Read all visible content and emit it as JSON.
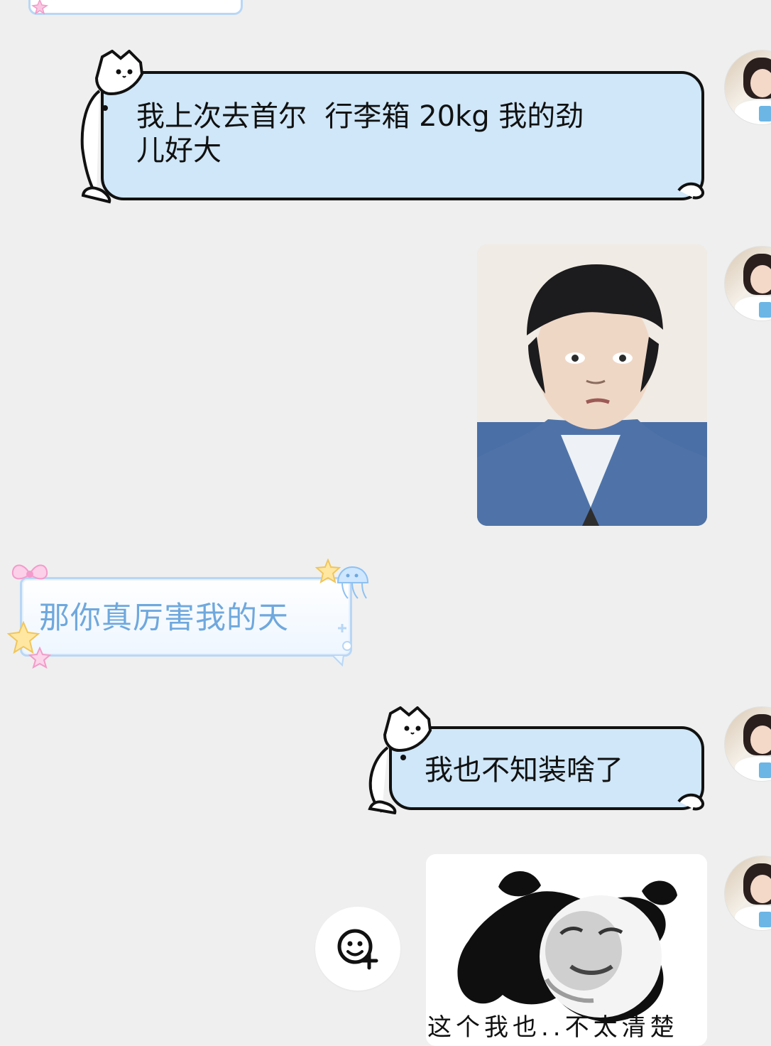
{
  "messages": {
    "m1": {
      "text": "我上次去首尔  行李箱 20kg 我的劲\n儿好大"
    },
    "m2": {
      "text": "那你真厉害我的天"
    },
    "m3": {
      "text": "我也不知装啥了"
    },
    "m4": {
      "caption": "这个我也..不太清楚"
    }
  },
  "icons": {
    "avatar": "avatar",
    "emoji_add": "emoji-add-icon",
    "bow": "bow-icon",
    "star": "star-icon",
    "jellyfish": "jellyfish-icon"
  },
  "colors": {
    "background": "#efefef",
    "cat_bubble": "#cfe7f8",
    "cute_bubble_text": "#6fa8dd",
    "cute_bubble_border": "#b8d7f6"
  }
}
